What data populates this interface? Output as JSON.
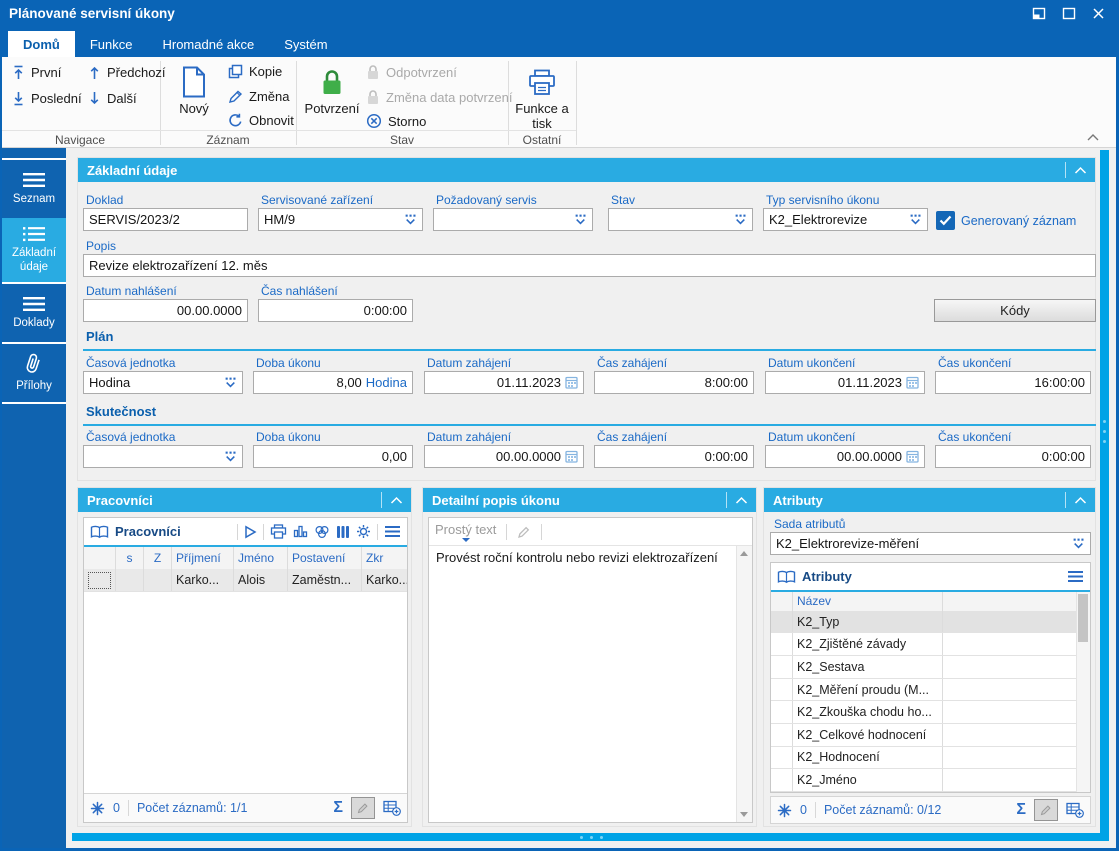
{
  "colors": {
    "titlebar": "#0a64b6",
    "accent": "#29abe2",
    "sidebar": "#0f63b0",
    "label_blue": "#1b6ac6",
    "icon_blue": "#2b6bc4",
    "confirm_green": "#3fae49",
    "splitter": "#00a3e6"
  },
  "icons": {
    "sigma": "Σ",
    "window": [
      "restore",
      "maximize",
      "close"
    ],
    "dropdown": "dots-chevron",
    "calendar": "calendar-grid",
    "flag": "asterisk"
  },
  "titlebar": {
    "title": "Plánované servisní úkony"
  },
  "tabs": {
    "domu": "Domů",
    "funkce": "Funkce",
    "hromadne": "Hromadné akce",
    "system": "Systém"
  },
  "ribbon": {
    "groups": {
      "navigace": "Navigace",
      "zaznam": "Záznam",
      "stav": "Stav",
      "ostatni": "Ostatní"
    },
    "prvni": "První",
    "predchozi": "Předchozí",
    "posledni": "Poslední",
    "dalsi": "Další",
    "novy": "Nový",
    "kopie": "Kopie",
    "zmena": "Změna",
    "obnovit": "Obnovit",
    "potvrzeni": "Potvrzení",
    "odpotvrzeni": "Odpotvrzení",
    "zmena_data": "Změna data potvrzení",
    "storno": "Storno",
    "funkce_tisk": "Funkce a tisk"
  },
  "sidebar": {
    "seznam": "Seznam",
    "zakladni": "Základní údaje",
    "doklady": "Doklady",
    "prilohy": "Přílohy"
  },
  "form": {
    "header": "Základní údaje",
    "doklad_label": "Doklad",
    "doklad_value": "SERVIS/2023/2",
    "zarizeni_label": "Servisované zařízení",
    "zarizeni_value": "HM/9",
    "pozadovany_label": "Požadovaný servis",
    "pozadovany_value": "",
    "stav_label": "Stav",
    "stav_value": "",
    "typ_label": "Typ servisního úkonu",
    "typ_value": "K2_Elektrorevize",
    "generovany_label": "Generovaný záznam",
    "generovany_checked": true,
    "popis_label": "Popis",
    "popis_value": "Revize elektrozařízení 12. měs",
    "datum_nahlaseni_label": "Datum nahlášení",
    "datum_nahlaseni_value": "00.00.0000",
    "cas_nahlaseni_label": "Čas nahlášení",
    "cas_nahlaseni_value": "0:00:00",
    "kody_label": "Kódy",
    "plan": {
      "title": "Plán",
      "casova_label": "Časová jednotka",
      "casova_value": "Hodina",
      "doba_label": "Doba úkonu",
      "doba_value": "8,00",
      "doba_unit": "Hodina",
      "datum_zahajeni_label": "Datum zahájení",
      "datum_zahajeni_value": "01.11.2023",
      "cas_zahajeni_label": "Čas zahájení",
      "cas_zahajeni_value": "8:00:00",
      "datum_ukonceni_label": "Datum ukončení",
      "datum_ukonceni_value": "01.11.2023",
      "cas_ukonceni_label": "Čas ukončení",
      "cas_ukonceni_value": "16:00:00"
    },
    "skutecnost": {
      "title": "Skutečnost",
      "casova_label": "Časová jednotka",
      "casova_value": "",
      "doba_label": "Doba úkonu",
      "doba_value": "0,00",
      "doba_unit": "",
      "datum_zahajeni_label": "Datum zahájení",
      "datum_zahajeni_value": "00.00.0000",
      "cas_zahajeni_label": "Čas zahájení",
      "cas_zahajeni_value": "0:00:00",
      "datum_ukonceni_label": "Datum ukončení",
      "datum_ukonceni_value": "00.00.0000",
      "cas_ukonceni_label": "Čas ukončení",
      "cas_ukonceni_value": "0:00:00"
    }
  },
  "workers": {
    "header": "Pracovníci",
    "grid_title": "Pracovníci",
    "columns": [
      "s",
      "Z",
      "Příjmení",
      "Jméno",
      "Postavení",
      "Zkr"
    ],
    "row": {
      "s": "",
      "z": "",
      "prijmeni": "Karko...",
      "jmeno": "Alois",
      "postaveni": "Zaměstn...",
      "zkr": "Karko..."
    },
    "status": {
      "flag_count": "0",
      "records": "Počet záznamů: 1/1"
    }
  },
  "detail": {
    "header": "Detailní popis úkonu",
    "mode": "Prostý text",
    "text": "Provést roční kontrolu nebo revizi elektrozařízení"
  },
  "attributes": {
    "header": "Atributy",
    "sada_label": "Sada atributů",
    "sada_value": "K2_Elektrorevize-měření",
    "grid_title": "Atributy",
    "name_column": "Název",
    "rows": [
      "K2_Typ",
      "K2_Zjištěné závady",
      "K2_Sestava",
      "K2_Měření proudu (M...",
      "K2_Zkouška chodu ho...",
      "K2_Celkové hodnocení",
      "K2_Hodnocení",
      "K2_Jméno"
    ],
    "status": {
      "flag_count": "0",
      "records": "Počet záznamů: 0/12"
    }
  }
}
